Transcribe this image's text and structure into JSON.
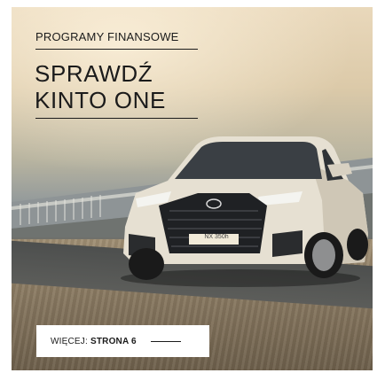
{
  "promo": {
    "eyebrow": "PROGRAMY FINANSOWE",
    "headline_line1": "SPRAWDŹ",
    "headline_line2": "KINTO ONE",
    "cta_prefix": "WIĘCEJ:",
    "cta_strong": "STRONA 6",
    "plate_text": "NX 350h"
  },
  "colors": {
    "text": "#1b1b1b",
    "cta_background": "#ffffff",
    "car_body": "#e6e0d2"
  }
}
